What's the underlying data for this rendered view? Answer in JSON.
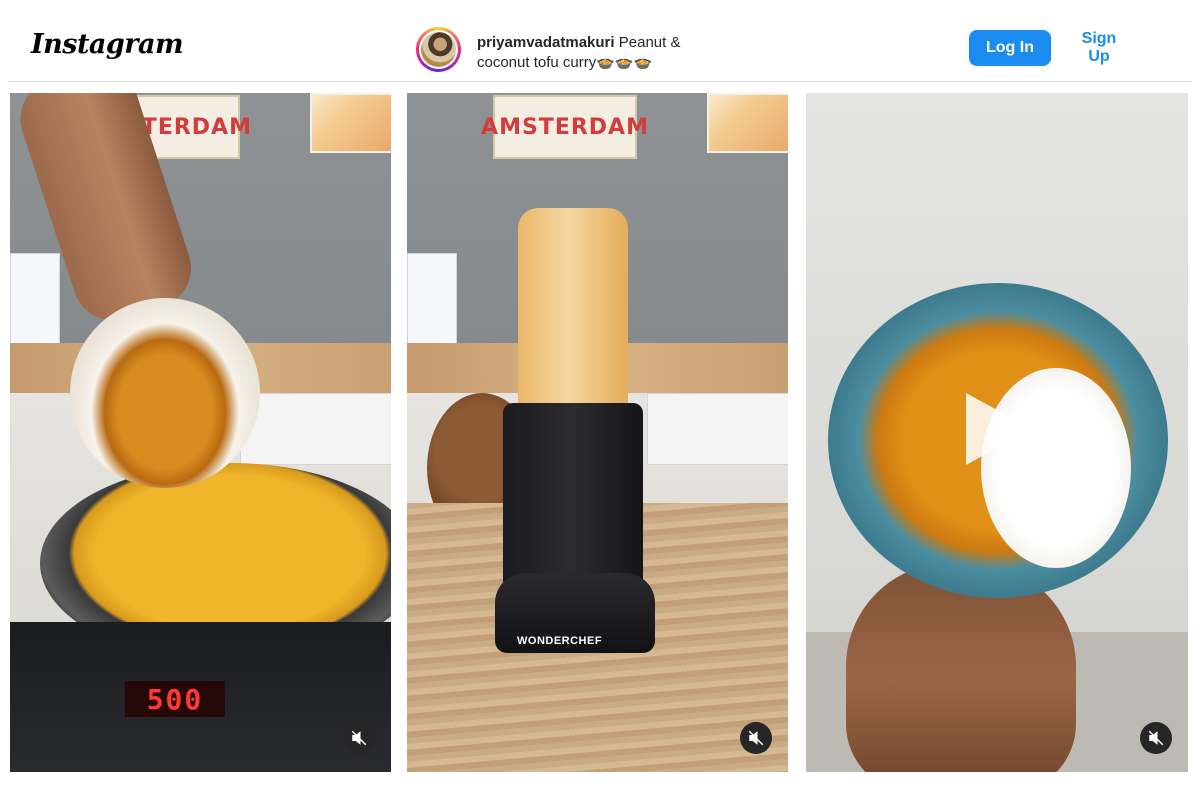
{
  "header": {
    "logo_text": "Instagram",
    "username": "priyamvadatmakuri",
    "caption": "Peanut & coconut tofu curry🍲🍲🍲",
    "login_label": "Log In",
    "signup_label": "Sign Up"
  },
  "colors": {
    "primary_button": "#1a8cf0",
    "link": "#1a8cf0",
    "text": "#262626"
  },
  "posts": [
    {
      "name": "reel-1",
      "scene": "tofu-into-pan",
      "sign_text": "AMSTERDAM",
      "display_text": "500",
      "brand_text": "",
      "mute_icon": "muted-speaker-icon"
    },
    {
      "name": "reel-2",
      "scene": "blender",
      "sign_text": "AMSTERDAM",
      "display_text": "",
      "brand_text": "WONDERCHEF",
      "mute_icon": "muted-speaker-icon"
    },
    {
      "name": "reel-3",
      "scene": "curry-bowl",
      "sign_text": "",
      "display_text": "",
      "brand_text": "",
      "mute_icon": "muted-speaker-icon",
      "play_icon": "play-icon"
    }
  ]
}
